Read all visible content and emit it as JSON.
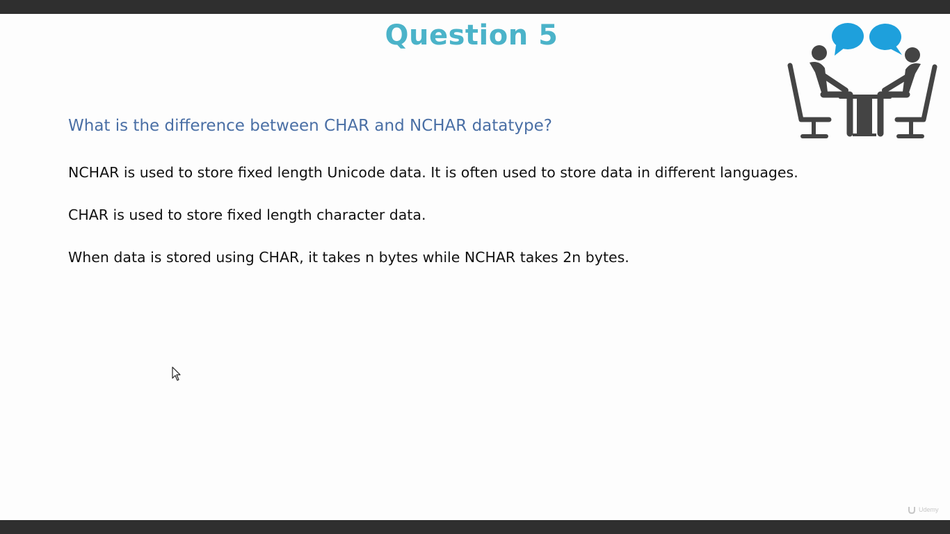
{
  "slide": {
    "title": "Question 5",
    "question": "What is the difference between CHAR and NCHAR datatype?",
    "answers": [
      "NCHAR is used to store fixed length Unicode data. It is often used to store data in different languages.",
      "CHAR is used to store fixed length character data.",
      "When data is stored using CHAR, it takes n bytes while NCHAR takes 2n bytes."
    ],
    "illustration_icon": "interview-people-talking-icon",
    "watermark_text": "Udemy"
  },
  "colors": {
    "title": "#4bb3c9",
    "question": "#4a6fa5",
    "body_text": "#111111",
    "speech_bubble": "#1ea0dc",
    "figure": "#444444",
    "bars": "#2f2f2f",
    "slide_background": "#fdfdfd"
  }
}
